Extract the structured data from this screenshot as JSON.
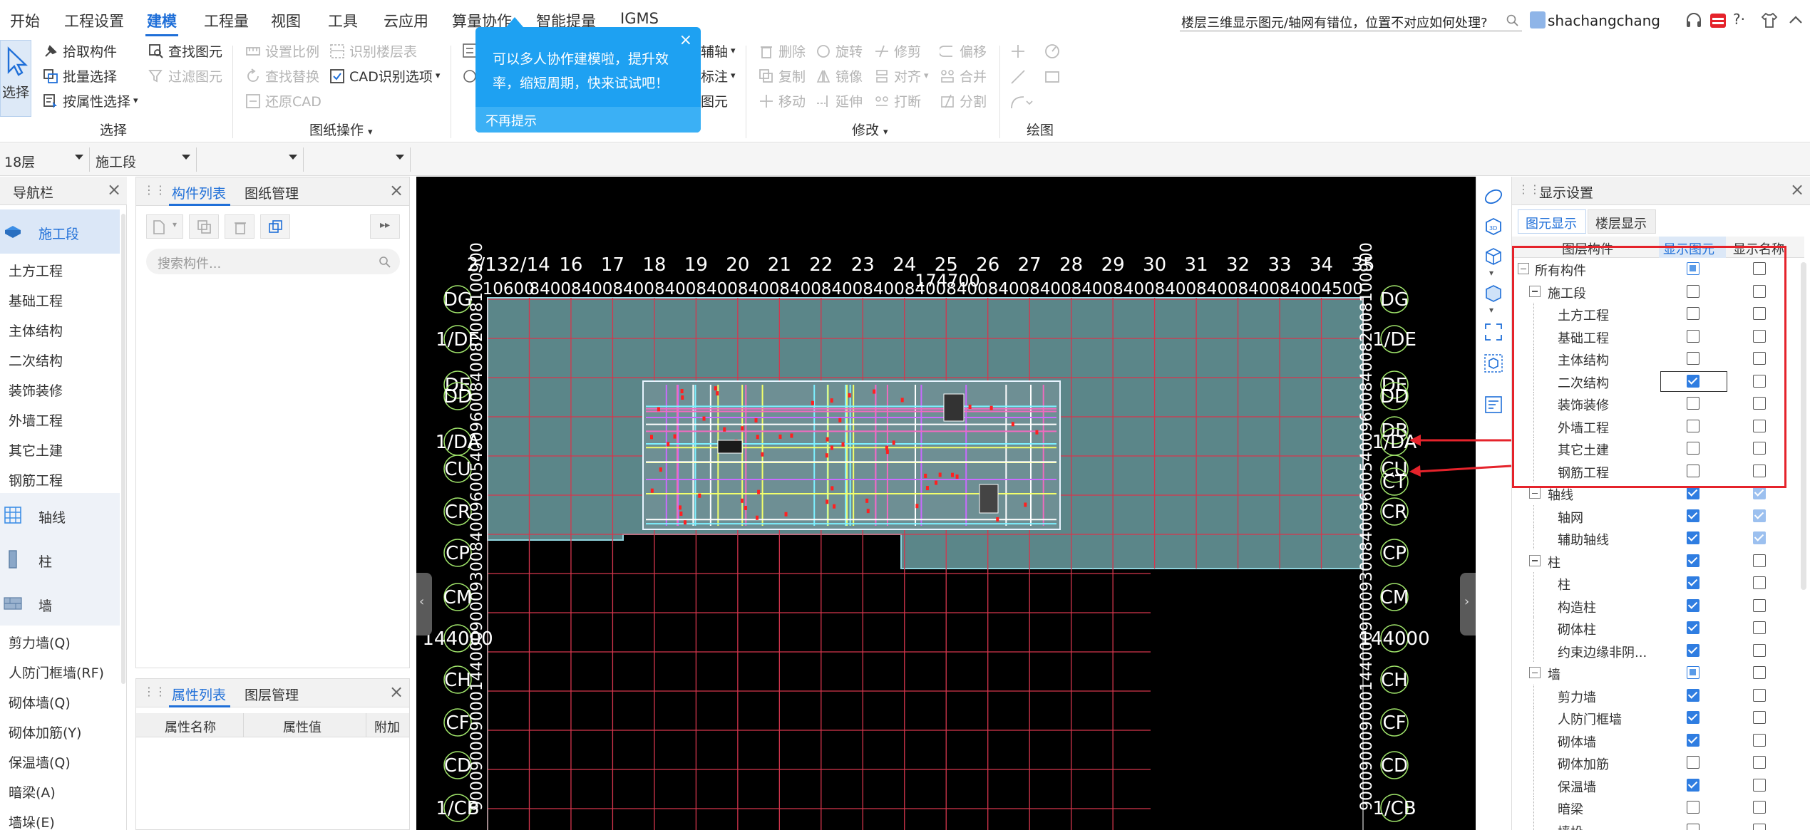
{
  "menu": {
    "items": [
      "开始",
      "工程设置",
      "建模",
      "工程量",
      "视图",
      "工具",
      "云应用",
      "算量协作",
      "智能提量",
      "IGMS"
    ],
    "active_index": 2,
    "question": "楼层三维显示图元/轴网有错位，位置不对应如何处理?",
    "user": "shachangchang",
    "help_label": "?·"
  },
  "ribbon": {
    "select_button": "选择",
    "pick_component": "拾取构件",
    "batch_select": "批量选择",
    "select_by_attr": "按属性选择",
    "find_element": "查找图元",
    "filter_element": "过滤图元",
    "set_scale": "设置比例",
    "identify_floor_table": "识别楼层表",
    "find_replace": "查找替换",
    "cad_options": "CAD识别选项",
    "restore_cad": "还原CAD",
    "aux_axis": "辅轴",
    "annotation": "标注",
    "element": "图元",
    "delete": "删除",
    "rotate": "旋转",
    "trim": "修剪",
    "offset": "偏移",
    "copy": "复制",
    "mirror": "镜像",
    "align": "对齐",
    "merge": "合并",
    "move": "移动",
    "extend": "延伸",
    "break": "打断",
    "split": "分割",
    "groups": {
      "select": "选择",
      "drawing_ops": "图纸操作",
      "modify": "修改",
      "draw": "绘图"
    }
  },
  "tooltip": {
    "text": "可以多人协作建模啦，提升效率，缩短周期，快来试试吧！",
    "dismiss": "不再提示",
    "close": "×"
  },
  "selectors": {
    "floor": "18层",
    "stage": "施工段",
    "third": "",
    "fourth": ""
  },
  "nav": {
    "title": "导航栏",
    "items": [
      {
        "label": "施工段",
        "icon": "construction-stage-icon",
        "active": true
      },
      {
        "label": "土方工程"
      },
      {
        "label": "基础工程"
      },
      {
        "label": "主体结构"
      },
      {
        "label": "二次结构"
      },
      {
        "label": "装饰装修"
      },
      {
        "label": "外墙工程"
      },
      {
        "label": "其它土建"
      },
      {
        "label": "钢筋工程"
      },
      {
        "label": "轴线",
        "icon": "axis-grid-icon"
      },
      {
        "label": "柱",
        "icon": "column-icon"
      },
      {
        "label": "墙",
        "icon": "wall-icon"
      },
      {
        "label": "剪力墙(Q)"
      },
      {
        "label": "人防门框墙(RF)"
      },
      {
        "label": "砌体墙(Q)"
      },
      {
        "label": "砌体加筋(Y)"
      },
      {
        "label": "保温墙(Q)"
      },
      {
        "label": "暗梁(A)"
      },
      {
        "label": "墙垛(E)"
      }
    ]
  },
  "component_panel": {
    "tab1": "构件列表",
    "tab2": "图纸管理",
    "search_placeholder": "搜索构件..."
  },
  "property_panel": {
    "tab1": "属性列表",
    "tab2": "图层管理",
    "col1": "属性名称",
    "col2": "属性值",
    "col3": "附加"
  },
  "canvas": {
    "top_axes": [
      "2/13",
      "2/14",
      "16",
      "17",
      "18",
      "19",
      "20",
      "21",
      "22",
      "23",
      "24",
      "25",
      "26",
      "27",
      "28",
      "29",
      "30",
      "31",
      "32",
      "33",
      "34",
      "35"
    ],
    "top_dims": [
      "10600",
      "8400",
      "8400",
      "8400",
      "8400",
      "8400",
      "8400",
      "8400",
      "8400",
      "8400",
      "8400",
      "8400",
      "8400",
      "8400",
      "8400",
      "8400",
      "8400",
      "8400",
      "8400",
      "8400",
      "4500"
    ],
    "total_dim": "174700",
    "left_axes": [
      "DG",
      "1/DE",
      "DE",
      "DD",
      "1/DA",
      "CU",
      "CR",
      "CP",
      "CM",
      "144000",
      "CH",
      "CF",
      "CD",
      "1/CB"
    ],
    "right_axes": [
      "DG",
      "1/DE",
      "DE",
      "DD",
      "DB",
      "1/DA",
      "CU",
      "CT",
      "CR",
      "CP",
      "CM",
      "144000",
      "CH",
      "CF",
      "CD",
      "1/CB"
    ]
  },
  "display_panel": {
    "title": "显示设置",
    "tab1": "图元显示",
    "tab2": "楼层显示",
    "col1": "图层构件",
    "col2": "显示图元",
    "col3": "显示名称",
    "rows": [
      {
        "label": "所有构件",
        "level": 0,
        "expander": true,
        "show": "part",
        "name": "off"
      },
      {
        "label": "施工段",
        "level": 1,
        "expander": true,
        "show": "off",
        "name": "off"
      },
      {
        "label": "土方工程",
        "level": 2,
        "show": "off",
        "name": "off"
      },
      {
        "label": "基础工程",
        "level": 2,
        "show": "off",
        "name": "off"
      },
      {
        "label": "主体结构",
        "level": 2,
        "show": "off",
        "name": "off"
      },
      {
        "label": "二次结构",
        "level": 2,
        "show": "on",
        "name": "off",
        "focused": true
      },
      {
        "label": "装饰装修",
        "level": 2,
        "show": "off",
        "name": "off"
      },
      {
        "label": "外墙工程",
        "level": 2,
        "show": "off",
        "name": "off"
      },
      {
        "label": "其它土建",
        "level": 2,
        "show": "off",
        "name": "off"
      },
      {
        "label": "钢筋工程",
        "level": 2,
        "show": "off",
        "name": "off"
      },
      {
        "label": "轴线",
        "level": 1,
        "expander": true,
        "show": "on",
        "name": "dim"
      },
      {
        "label": "轴网",
        "level": 2,
        "show": "on",
        "name": "dim"
      },
      {
        "label": "辅助轴线",
        "level": 2,
        "show": "on",
        "name": "dim"
      },
      {
        "label": "柱",
        "level": 1,
        "expander": true,
        "show": "on",
        "name": "off"
      },
      {
        "label": "柱",
        "level": 2,
        "show": "on",
        "name": "off"
      },
      {
        "label": "构造柱",
        "level": 2,
        "show": "on",
        "name": "off"
      },
      {
        "label": "砌体柱",
        "level": 2,
        "show": "on",
        "name": "off"
      },
      {
        "label": "约束边缘非阴...",
        "level": 2,
        "show": "on",
        "name": "off"
      },
      {
        "label": "墙",
        "level": 1,
        "expander": true,
        "show": "part",
        "name": "off"
      },
      {
        "label": "剪力墙",
        "level": 2,
        "show": "on",
        "name": "off"
      },
      {
        "label": "人防门框墙",
        "level": 2,
        "show": "on",
        "name": "off"
      },
      {
        "label": "砌体墙",
        "level": 2,
        "show": "on",
        "name": "off"
      },
      {
        "label": "砌体加筋",
        "level": 2,
        "show": "off",
        "name": "off"
      },
      {
        "label": "保温墙",
        "level": 2,
        "show": "on",
        "name": "off"
      },
      {
        "label": "暗梁",
        "level": 2,
        "show": "off",
        "name": "off"
      },
      {
        "label": "墙垛",
        "level": 2,
        "show": "off",
        "name": "off"
      }
    ]
  },
  "colors": {
    "accent": "#1f6fd8",
    "tooltip": "#1ea1f2",
    "highlight": "#e5232b",
    "slab": "#5b8689",
    "grid": "#d5364d",
    "canvas": "#000000"
  }
}
